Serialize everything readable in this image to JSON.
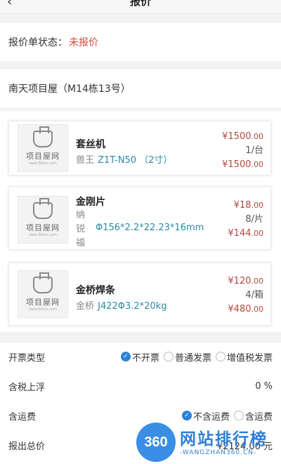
{
  "header": {
    "back_icon": "‹",
    "title": "报价"
  },
  "status": {
    "label": "报价单状态：",
    "value": "未报价",
    "value_color": "#d24a3a"
  },
  "project": {
    "name": "南天项目屋（M14栋13号）"
  },
  "items": [
    {
      "logo_text": "项目屋网",
      "logo_url": "www.58xm.com",
      "name": "套丝机",
      "brand": "兽王",
      "spec": "Z1T-N50 （2寸）",
      "unit_price_symbol": "¥",
      "unit_price": "1500",
      "unit_price_dec": ".00",
      "qty": "1/台",
      "total_symbol": "¥",
      "total": "1500",
      "total_dec": ".00"
    },
    {
      "logo_text": "项目屋网",
      "logo_url": "www.58xm.com",
      "name": "金刚片",
      "brand_lines": [
        "纳",
        "锐",
        "福"
      ],
      "spec": "Φ156*2.2*22.23*16mm",
      "unit_price_symbol": "¥",
      "unit_price": "18",
      "unit_price_dec": ".00",
      "qty": "8/片",
      "total_symbol": "¥",
      "total": "144",
      "total_dec": ".00"
    },
    {
      "logo_text": "项目屋网",
      "logo_url": "www.58xm.com",
      "name": "金桥焊条",
      "brand": "金桥",
      "spec": "J422Φ3.2*20kg",
      "unit_price_symbol": "¥",
      "unit_price": "120",
      "unit_price_dec": ".00",
      "qty": "4/箱",
      "total_symbol": "¥",
      "total": "480",
      "total_dec": ".00"
    }
  ],
  "invoice": {
    "label": "开票类型",
    "options": [
      {
        "label": "不开票",
        "selected": true
      },
      {
        "label": "普通发票",
        "selected": false
      },
      {
        "label": "增值税发票",
        "selected": false
      }
    ]
  },
  "tax_markup": {
    "label": "含税上浮",
    "value": "0 %"
  },
  "freight": {
    "label": "含运费",
    "options": [
      {
        "label": "不含运费",
        "selected": true
      },
      {
        "label": "含运费",
        "selected": false
      }
    ]
  },
  "total": {
    "label": "报出总价",
    "value": "¥2124.00 元"
  },
  "watermark": {
    "badge": "360",
    "title": "网站排行榜",
    "subtitle": "-WANGZHAN360.CN-"
  },
  "colors": {
    "accent": "#2b83d6",
    "price_red": "#b3473d",
    "spec_teal": "#2b8aa8"
  }
}
